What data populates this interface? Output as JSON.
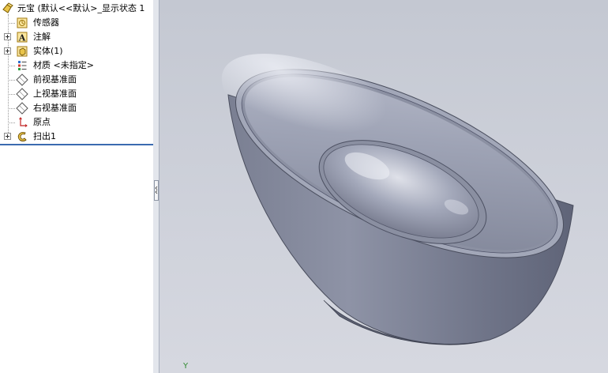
{
  "tree": {
    "root_label": "元宝 (默认<<默认>_显示状态 1",
    "items": [
      {
        "label": "传感器",
        "icon": "sensor-icon"
      },
      {
        "label": "注解",
        "icon": "annotation-icon"
      },
      {
        "label": "实体(1)",
        "icon": "solid-body-icon"
      },
      {
        "label": "材质 <未指定>",
        "icon": "material-icon"
      },
      {
        "label": "前视基准面",
        "icon": "plane-icon"
      },
      {
        "label": "上视基准面",
        "icon": "plane-icon"
      },
      {
        "label": "右视基准面",
        "icon": "plane-icon"
      },
      {
        "label": "原点",
        "icon": "origin-icon"
      },
      {
        "label": "扫出1",
        "icon": "sweep-feature-icon"
      }
    ]
  },
  "viewport": {
    "axis_label": "Y",
    "model_color": "#8e93a6"
  },
  "colors": {
    "accent": "#3b6bb0",
    "axis": "#2f8a2f"
  }
}
